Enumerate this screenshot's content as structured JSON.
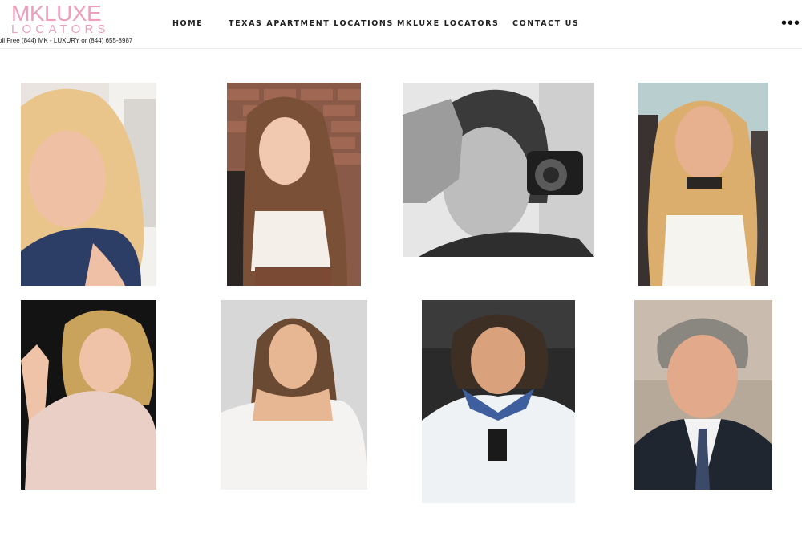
{
  "logo": {
    "line1": "MKLUXE",
    "line2": "LOCATORS",
    "phone": "oll Free (844) MK - LUXURY or (844) 655-8987"
  },
  "nav": {
    "items": [
      {
        "label": "HOME"
      },
      {
        "label": "TEXAS APARTMENT LOCATIONS"
      },
      {
        "label": "MKLUXE LOCATORS"
      },
      {
        "label": "CONTACT US"
      }
    ],
    "more_icon": "more-dots-icon",
    "more_glyph": "•••"
  },
  "colors": {
    "brand_pink": "#ef9fbe",
    "text_dark": "#222222"
  },
  "team_photos": [
    {
      "subject": "team-member-1"
    },
    {
      "subject": "team-member-2"
    },
    {
      "subject": "team-member-3"
    },
    {
      "subject": "team-member-4"
    },
    {
      "subject": "team-member-5"
    },
    {
      "subject": "team-member-6"
    },
    {
      "subject": "team-member-7"
    },
    {
      "subject": "team-member-8"
    }
  ]
}
